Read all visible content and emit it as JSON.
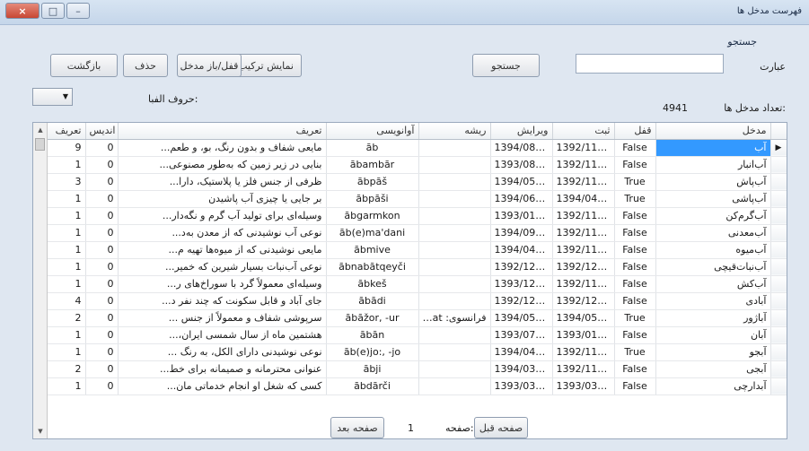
{
  "window": {
    "title": "فهرست مدخل ها",
    "close": "×",
    "max": "□",
    "min": "–"
  },
  "search": {
    "group": "جستجو",
    "phrase_label": "عبارت",
    "input_value": "",
    "button": "جستجو"
  },
  "toolbar": {
    "show_combo": "نمایش ترکیب",
    "lock": "قفل/باز مدخل",
    "delete": "حذف",
    "back": "بازگشت"
  },
  "count": {
    "label": "تعداد مدخل ها:",
    "value": "4941"
  },
  "alphabet": {
    "label": "حروف الفبا:",
    "selected": ""
  },
  "grid": {
    "columns": [
      "مدخل",
      "قفل",
      "ثبت",
      "ویرایش",
      "ریشه",
      "آوانویسی",
      "تعریف",
      "اندیس",
      "تعریف"
    ],
    "rows": [
      [
        "آب",
        "False",
        "1392/11/17",
        "1394/08/11",
        "",
        "āb",
        "مایعی شفاف و بدون رنگ، بو، و طعم...",
        "0",
        "9"
      ],
      [
        "آب‌انبار",
        "False",
        "1392/11/19",
        "1393/08/03",
        "",
        "ābambār",
        "بنایی در زیر زمین که به‌طور مصنوعی...",
        "0",
        "1"
      ],
      [
        "آب‌پاش",
        "True",
        "1392/11/19",
        "1394/05/05",
        "",
        "ābpāš",
        "ظرفی از جنس فلز یا پلاستیک، دارا...",
        "0",
        "3"
      ],
      [
        "آب‌پاشی",
        "True",
        "1394/04/11",
        "1394/06/17",
        "",
        "ābpāši",
        "بر جایی یا چیزی آب پاشیدن",
        "0",
        "1"
      ],
      [
        "آب‌گرم‌کن",
        "False",
        "1392/11/23",
        "1393/01/26",
        "",
        "ābgarmkon",
        "وسیله‌ای برای تولید آب گرم و نگه‌دار...",
        "0",
        "1"
      ],
      [
        "آب‌معدنی",
        "False",
        "1392/11/19",
        "1394/09/02",
        "",
        "āb(e)ma'dani",
        "نوعی آب نوشیدنی که از معدن به‌د...",
        "0",
        "1"
      ],
      [
        "آب‌میوه",
        "False",
        "1392/11/19",
        "1394/04/27",
        "",
        "ābmive",
        "مایعی نوشیدنی که از میوه‌ها تهیه م...",
        "0",
        "1"
      ],
      [
        "آب‌نبات‌قیچی",
        "False",
        "1392/12/09",
        "1392/12/10",
        "",
        "ābnabātqeyči",
        "نوعی آب‌نبات بسیار شیرین که خمیر...",
        "0",
        "1"
      ],
      [
        "آب‌کش",
        "False",
        "1392/11/19",
        "1393/12/26",
        "",
        "ābkeš",
        "وسیله‌ای معمولاً گرد با سوراخ‌های ر...",
        "0",
        "1"
      ],
      [
        "آبادی",
        "False",
        "1392/12/17",
        "1392/12/18",
        "",
        "ābādi",
        "جای آباد و قابل سکونت که چند نفر د...",
        "0",
        "4"
      ],
      [
        "آباژور",
        "True",
        "1394/05/02",
        "1394/05/14",
        "فرانسوی: abat-...",
        "ābāžor, -ur",
        "سرپوشی شفاف و معمولاً از جنس ...",
        "0",
        "2"
      ],
      [
        "آبان",
        "False",
        "1393/01/25",
        "1393/07/14",
        "",
        "ābān",
        "هشتمین ماه از سال شمسی ایران،...",
        "0",
        "1"
      ],
      [
        "آبجو",
        "True",
        "1392/11/18",
        "1394/04/11",
        "",
        "āb(e)jo:, -jo",
        "نوعی نوشیدنی دارای الکل، به رنگ ...",
        "0",
        "1"
      ],
      [
        "آبجی",
        "False",
        "1392/11/19",
        "1394/03/01",
        "",
        "ābji",
        "عنوانی محترمانه و صمیمانه برای خط...",
        "0",
        "2"
      ],
      [
        "آبدارچی",
        "False",
        "1393/03/22",
        "1393/03/23",
        "",
        "ābdārči",
        "کسی که شغل او انجام خدماتی مان...",
        "0",
        "1"
      ]
    ]
  },
  "pager": {
    "prev": "صفحه قبل",
    "page_label": "صفحه:",
    "page": "1",
    "next": "صفحه بعد"
  },
  "colors": {
    "selection": "#3399ff",
    "close_button": "#c74734"
  }
}
